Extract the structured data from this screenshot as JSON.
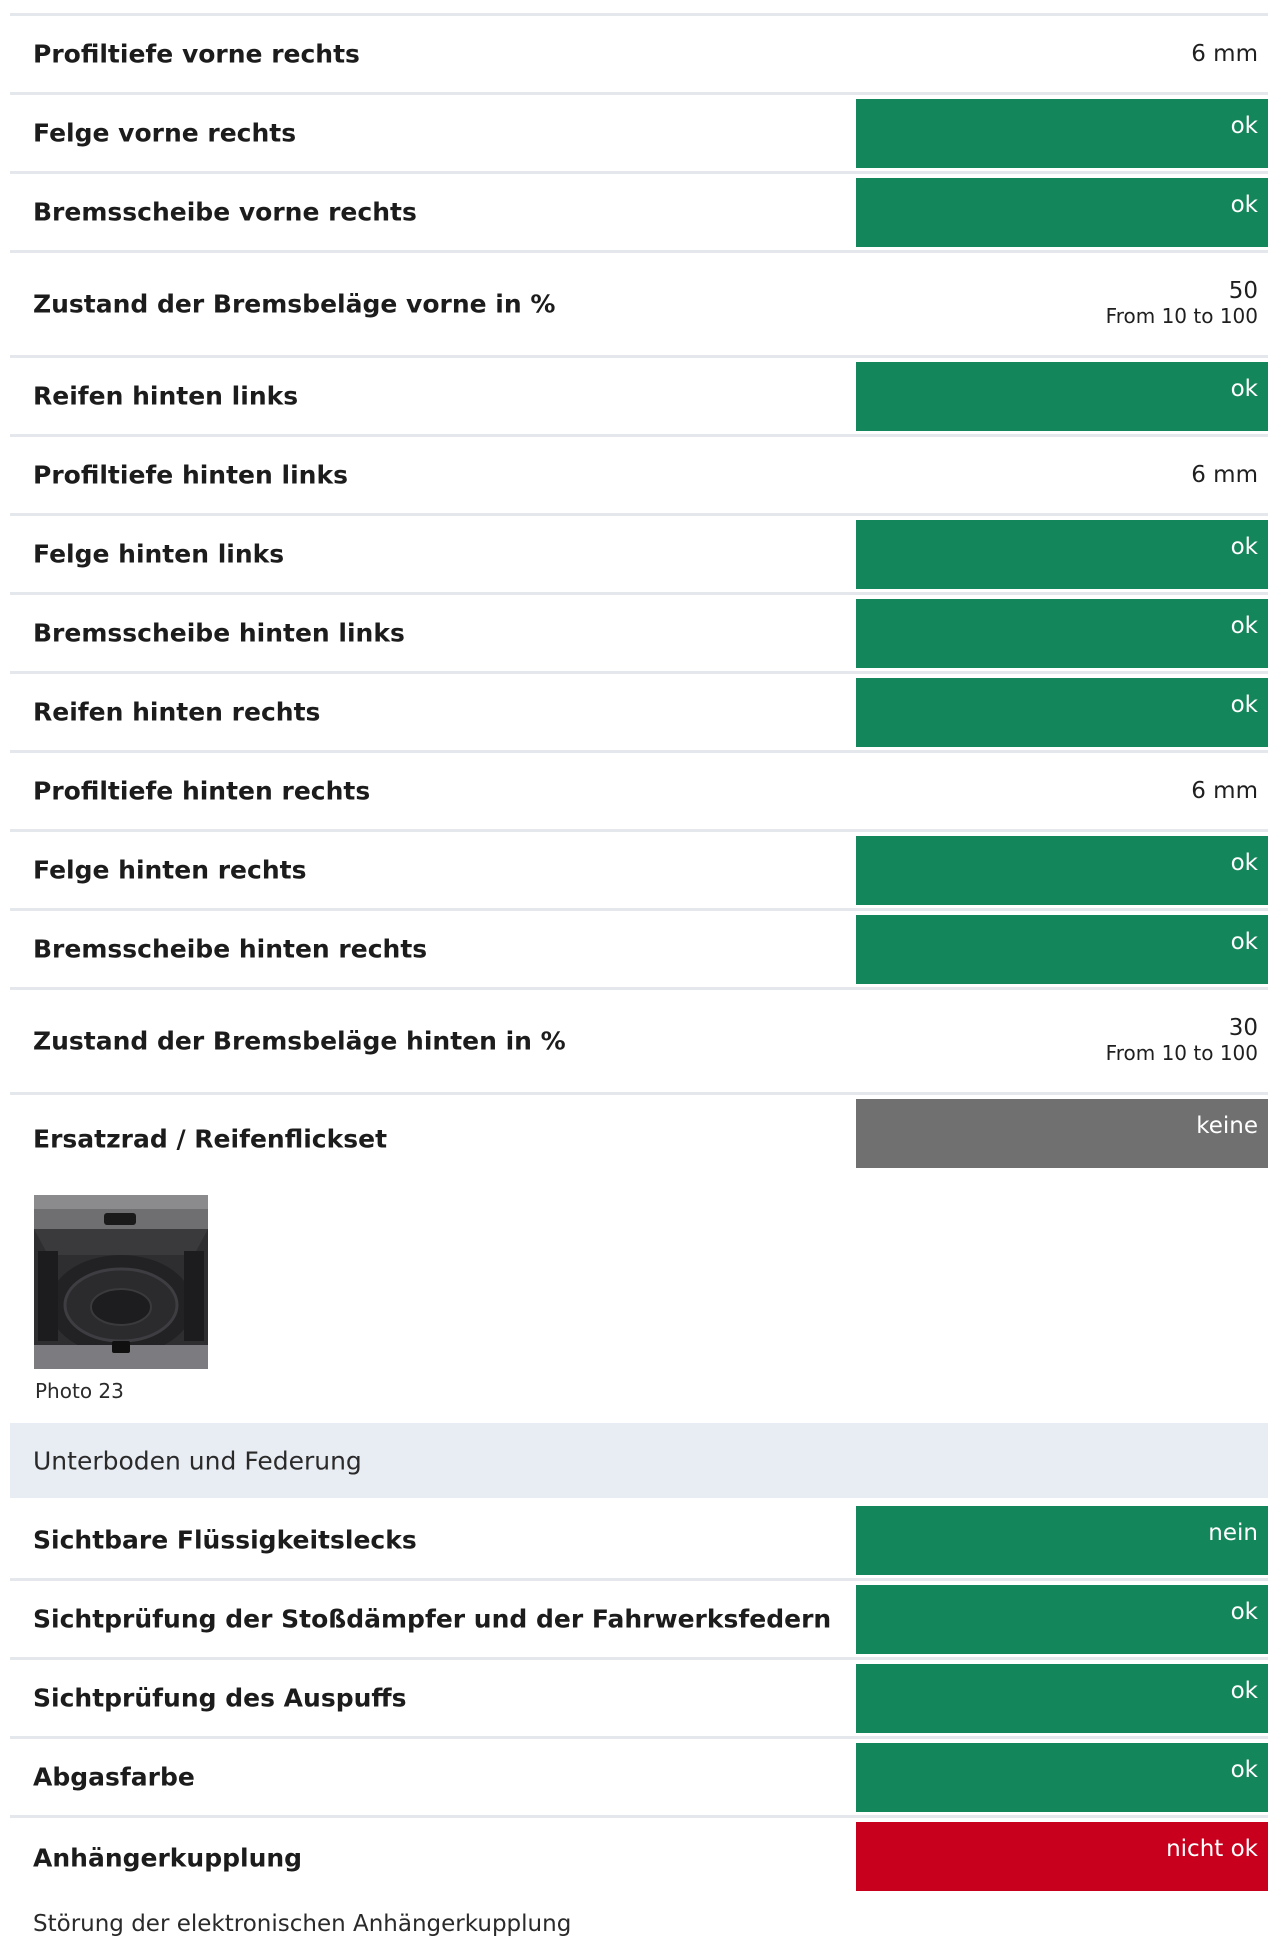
{
  "colors": {
    "ok_green": "#14865b",
    "neutral_gray": "#707070",
    "error_red": "#c8001e",
    "section_bg": "#e8ecf3",
    "divider": "#e4e7ec"
  },
  "rows_a": [
    {
      "label": "Profiltiefe vorne rechts",
      "value": "6 mm"
    },
    {
      "label": "Felge vorne rechts",
      "status": "ok"
    },
    {
      "label": "Bremsscheibe vorne rechts",
      "status": "ok"
    },
    {
      "label": "Zustand der Bremsbeläge vorne in %",
      "value": "50",
      "range": "From 10 to 100"
    },
    {
      "label": "Reifen hinten links",
      "status": "ok"
    },
    {
      "label": "Profiltiefe hinten links",
      "value": "6 mm"
    },
    {
      "label": "Felge hinten links",
      "status": "ok"
    },
    {
      "label": "Bremsscheibe hinten links",
      "status": "ok"
    },
    {
      "label": "Reifen hinten rechts",
      "status": "ok"
    },
    {
      "label": "Profiltiefe hinten rechts",
      "value": "6 mm"
    },
    {
      "label": "Felge hinten rechts",
      "status": "ok"
    },
    {
      "label": "Bremsscheibe hinten rechts",
      "status": "ok"
    },
    {
      "label": "Zustand der Bremsbeläge hinten in %",
      "value": "30",
      "range": "From 10 to 100"
    },
    {
      "label": "Ersatzrad / Reifenflickset",
      "status": "keine"
    }
  ],
  "photo": {
    "caption": "Photo 23"
  },
  "section": {
    "title": "Unterboden und Federung"
  },
  "rows_b": [
    {
      "label": "Sichtbare Flüssigkeitslecks",
      "status": "nein"
    },
    {
      "label": "Sichtprüfung der Stoßdämpfer und der Fahrwerksfedern",
      "status": "ok"
    },
    {
      "label": "Sichtprüfung des Auspuffs",
      "status": "ok"
    },
    {
      "label": "Abgasfarbe",
      "status": "ok"
    },
    {
      "label": "Anhängerkupplung",
      "status": "nicht ok"
    }
  ],
  "note": {
    "text": "Störung der elektronischen Anhängerkupplung"
  }
}
